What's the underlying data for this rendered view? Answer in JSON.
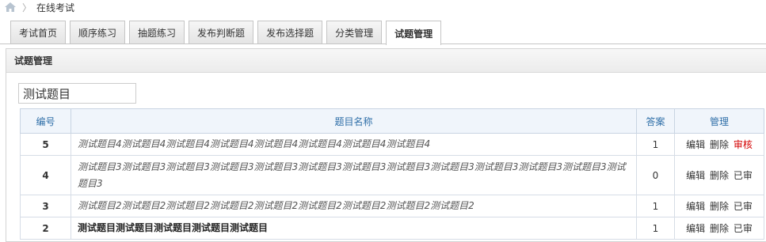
{
  "breadcrumb": {
    "current": "在线考试"
  },
  "tabs": [
    {
      "label": "考试首页"
    },
    {
      "label": "顺序练习"
    },
    {
      "label": "抽题练习"
    },
    {
      "label": "发布判断题"
    },
    {
      "label": "发布选择题"
    },
    {
      "label": "分类管理"
    },
    {
      "label": "试题管理"
    }
  ],
  "panel": {
    "title": "试题管理"
  },
  "search": {
    "value": "测试题目"
  },
  "table": {
    "headers": {
      "num": "编号",
      "title": "题目名称",
      "answer": "答案",
      "manage": "管理"
    },
    "rows": [
      {
        "num": "5",
        "title": "测试题目4测试题目4测试题目4测试题目4测试题目4测试题目4测试题目4测试题目4",
        "answer": "1",
        "edit": "编辑",
        "delete": "删除",
        "status": "审核"
      },
      {
        "num": "4",
        "title": "测试题目3测试题目3测试题目3测试题目3测试题目3测试题目3测试题目3测试题目3测试题目3测试题目3测试题目3测试题目3测试题目3",
        "answer": "0",
        "edit": "编辑",
        "delete": "删除",
        "status": "已审"
      },
      {
        "num": "3",
        "title": "测试题目2测试题目2测试题目2测试题目2测试题目2测试题目2测试题目2测试题目2测试题目2",
        "answer": "1",
        "edit": "编辑",
        "delete": "删除",
        "status": "已审"
      },
      {
        "num": "2",
        "title": "测试题目测试题目测试题目测试题目测试题目",
        "answer": "1",
        "edit": "编辑",
        "delete": "删除",
        "status": "已审"
      }
    ]
  },
  "colors": {
    "review": "#d40000",
    "header_text": "#2f6fa8"
  }
}
